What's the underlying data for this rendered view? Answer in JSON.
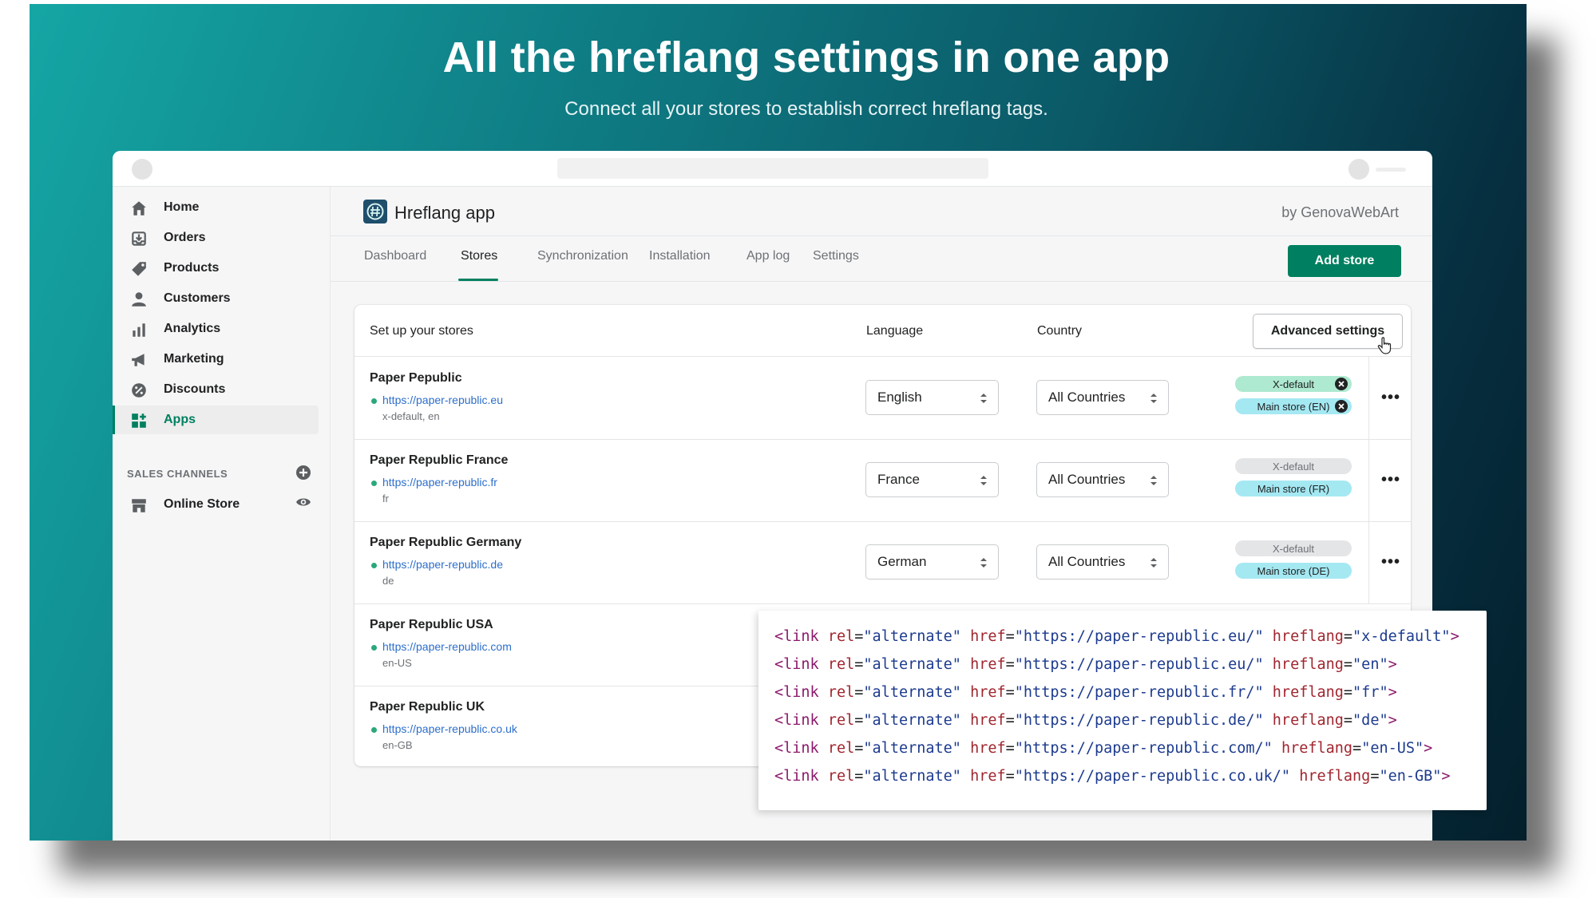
{
  "hero": {
    "title": "All the hreflang settings in one app",
    "subtitle": "Connect all your stores to establish correct hreflang tags."
  },
  "sidebar": {
    "items": [
      {
        "label": "Home",
        "icon": "home-icon"
      },
      {
        "label": "Orders",
        "icon": "orders-icon"
      },
      {
        "label": "Products",
        "icon": "tag-icon"
      },
      {
        "label": "Customers",
        "icon": "person-icon"
      },
      {
        "label": "Analytics",
        "icon": "bar-chart-icon"
      },
      {
        "label": "Marketing",
        "icon": "megaphone-icon"
      },
      {
        "label": "Discounts",
        "icon": "discount-icon"
      },
      {
        "label": "Apps",
        "icon": "apps-icon",
        "active": true
      }
    ],
    "sales_channels_heading": "SALES CHANNELS",
    "online_store": "Online Store"
  },
  "app": {
    "name": "Hreflang app",
    "by": "by GenovaWebArt",
    "tabs": [
      "Dashboard",
      "Stores",
      "Synchronization",
      "Installation",
      "App log",
      "Settings"
    ],
    "active_tab": "Stores",
    "add_store": "Add store"
  },
  "card": {
    "title": "Set up your stores",
    "language_header": "Language",
    "country_header": "Country",
    "advanced_settings": "Advanced settings"
  },
  "stores": [
    {
      "name": "Paper Pepublic",
      "url": "https://paper-republic.eu",
      "codes": "x-default, en",
      "language": "English",
      "country": "All Countries",
      "xdefault": "X-default",
      "xdefault_active": true,
      "main": "Main store (EN)",
      "main_removable": true
    },
    {
      "name": "Paper Republic France",
      "url": "https://paper-republic.fr",
      "codes": "fr",
      "language": "France",
      "country": "All Countries",
      "xdefault": "X-default",
      "xdefault_active": false,
      "main": "Main store (FR)",
      "main_removable": false
    },
    {
      "name": "Paper Republic Germany",
      "url": "https://paper-republic.de",
      "codes": "de",
      "language": "German",
      "country": "All Countries",
      "xdefault": "X-default",
      "xdefault_active": false,
      "main": "Main store (DE)",
      "main_removable": false
    },
    {
      "name": "Paper Republic USA",
      "url": "https://paper-republic.com",
      "codes": "en-US"
    },
    {
      "name": "Paper Republic UK",
      "url": "https://paper-republic.co.uk",
      "codes": "en-GB"
    }
  ],
  "code": [
    {
      "tag": "<link",
      "rel_attr": "rel",
      "rel": "\"alternate\"",
      "href_attr": "href",
      "href": "\"https://paper-republic.eu/\"",
      "hl_attr": "hreflang",
      "hl": "\"x-default\"",
      "end": ">"
    },
    {
      "tag": "<link",
      "rel_attr": "rel",
      "rel": "\"alternate\"",
      "href_attr": "href",
      "href": "\"https://paper-republic.eu/\"",
      "hl_attr": "hreflang",
      "hl": "\"en\"",
      "end": ">"
    },
    {
      "tag": "<link",
      "rel_attr": "rel",
      "rel": "\"alternate\"",
      "href_attr": "href",
      "href": "\"https://paper-republic.fr/\"",
      "hl_attr": "hreflang",
      "hl": "\"fr\"",
      "end": ">"
    },
    {
      "tag": "<link",
      "rel_attr": "rel",
      "rel": "\"alternate\"",
      "href_attr": "href",
      "href": "\"https://paper-republic.de/\"",
      "hl_attr": "hreflang",
      "hl": "\"de\"",
      "end": ">"
    },
    {
      "tag": "<link",
      "rel_attr": "rel",
      "rel": "\"alternate\"",
      "href_attr": "href",
      "href": "\"https://paper-republic.com/\"",
      "hl_attr": "hreflang",
      "hl": "\"en-US\"",
      "end": ">"
    },
    {
      "tag": "<link",
      "rel_attr": "rel",
      "rel": "\"alternate\"",
      "href_attr": "href",
      "href": "\"https://paper-republic.co.uk/\"",
      "hl_attr": "hreflang",
      "hl": "\"en-GB\"",
      "end": ">"
    }
  ],
  "colors": {
    "accent": "#008060",
    "xdefault_active": "#aee9d1",
    "main_pill": "#a4e8f2",
    "link": "#2c6ecb"
  }
}
